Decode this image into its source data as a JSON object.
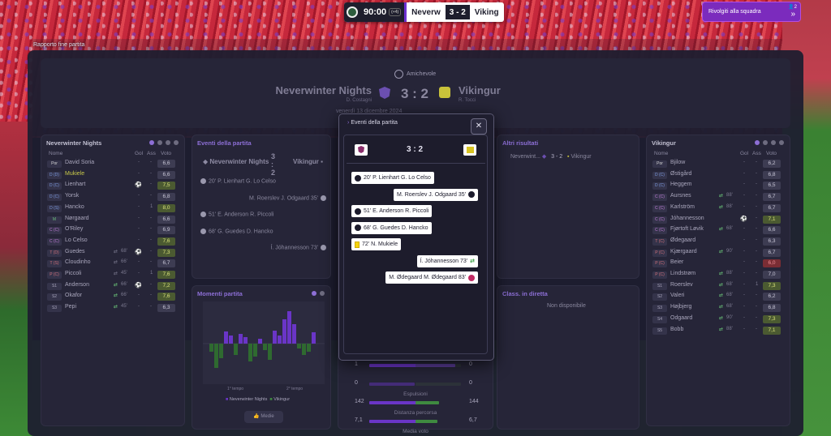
{
  "breadcrumb": "Rapporto fine partita",
  "scoreboard": {
    "time": "90:00",
    "extra": "(+4)",
    "home": "Neverw",
    "score": "3 - 2",
    "away": "Viking"
  },
  "team_talk": {
    "label": "Rivolgiti alla squadra",
    "badge": "2"
  },
  "header": {
    "competition": "Amichevole",
    "home_team": "Neverwinter Nights",
    "home_coach": "D. Costagni",
    "away_team": "Vikingur",
    "away_coach": "R. Tocci",
    "score": "3 : 2",
    "date": "venerdì 13 dicembre 2024"
  },
  "home_panel": {
    "title": "Neverwinter Nights",
    "columns": [
      "Nome",
      "Gol",
      "Ass",
      "Voto"
    ],
    "players": [
      {
        "pos": "Por",
        "name": "David Soria",
        "gol": "-",
        "ass": "-",
        "voto": "6,6",
        "r": "n",
        "t": "gk"
      },
      {
        "pos": "D (D)",
        "name": "Mukiele",
        "gol": "-",
        "ass": "-",
        "voto": "6,6",
        "r": "n",
        "t": "def",
        "hl": true
      },
      {
        "pos": "D (C)",
        "name": "Lienhart",
        "gol": "",
        "ass": "-",
        "voto": "7,5",
        "r": "g",
        "t": "def",
        "ball": true
      },
      {
        "pos": "D (C)",
        "name": "Yorsk",
        "gol": "-",
        "ass": "-",
        "voto": "6,8",
        "r": "n",
        "t": "def"
      },
      {
        "pos": "D (S)",
        "name": "Hancko",
        "gol": "-",
        "ass": "1",
        "voto": "8,0",
        "r": "g",
        "t": "def"
      },
      {
        "pos": "M",
        "name": "Nørgaard",
        "gol": "-",
        "ass": "-",
        "voto": "6,6",
        "r": "n",
        "t": "mid"
      },
      {
        "pos": "C (C)",
        "name": "O'Riley",
        "gol": "-",
        "ass": "-",
        "voto": "6,9",
        "r": "n",
        "t": "mixd"
      },
      {
        "pos": "C (C)",
        "name": "Lo Celso",
        "gol": "-",
        "ass": "-",
        "voto": "7,6",
        "r": "g",
        "t": "mixd"
      },
      {
        "pos": "T (D)",
        "name": "Guedes",
        "sub": "68'",
        "gol": "",
        "ass": "-",
        "voto": "7,3",
        "r": "g",
        "t": "att",
        "ball": true,
        "subout": true
      },
      {
        "pos": "T (S)",
        "name": "Cloudinho",
        "sub": "66'",
        "gol": "-",
        "ass": "-",
        "voto": "6,7",
        "r": "n",
        "t": "att",
        "subout": true
      },
      {
        "pos": "P (C)",
        "name": "Piccoli",
        "sub": "45'",
        "gol": "-",
        "ass": "1",
        "voto": "7,6",
        "r": "g",
        "t": "att",
        "subout": true
      },
      {
        "pos": "S1",
        "name": "Anderson",
        "sub": "66'",
        "gol": "",
        "ass": "-",
        "voto": "7,2",
        "r": "g",
        "t": "sub",
        "ball": true
      },
      {
        "pos": "S2",
        "name": "Okafor",
        "sub": "66'",
        "gol": "-",
        "ass": "-",
        "voto": "7,6",
        "r": "g",
        "t": "sub"
      },
      {
        "pos": "S3",
        "name": "Pepi",
        "sub": "45'",
        "gol": "-",
        "ass": "-",
        "voto": "6,3",
        "r": "n",
        "t": "sub"
      }
    ]
  },
  "away_panel": {
    "title": "Vikingur",
    "columns": [
      "Nome",
      "Gol",
      "Ass",
      "Voto"
    ],
    "players": [
      {
        "pos": "Por",
        "name": "Bjilow",
        "gol": "-",
        "ass": "-",
        "voto": "6,2",
        "r": "n",
        "t": "gk"
      },
      {
        "pos": "D (C)",
        "name": "Østigård",
        "gol": "-",
        "ass": "-",
        "voto": "6,8",
        "r": "n",
        "t": "def"
      },
      {
        "pos": "D (C)",
        "name": "Heggem",
        "gol": "-",
        "ass": "-",
        "voto": "6,5",
        "r": "n",
        "t": "def"
      },
      {
        "pos": "C (C)",
        "name": "Aursnes",
        "sub": "88'",
        "gol": "-",
        "ass": "-",
        "voto": "6,7",
        "r": "n",
        "t": "mixd"
      },
      {
        "pos": "C (C)",
        "name": "Karlström",
        "sub": "88'",
        "gol": "-",
        "ass": "-",
        "voto": "6,7",
        "r": "n",
        "t": "mixd"
      },
      {
        "pos": "C (C)",
        "name": "Jóhannesson",
        "gol": "",
        "ass": "-",
        "voto": "7,1",
        "r": "g",
        "t": "mixd",
        "ball": true
      },
      {
        "pos": "C (C)",
        "name": "Fjørtoft Løvik",
        "sub": "68'",
        "gol": "-",
        "ass": "-",
        "voto": "6,6",
        "r": "n",
        "t": "mixd"
      },
      {
        "pos": "T (C)",
        "name": "Ødegaard",
        "gol": "-",
        "ass": "-",
        "voto": "6,3",
        "r": "n",
        "t": "att"
      },
      {
        "pos": "P (C)",
        "name": "Kjærgaard",
        "sub": "90'",
        "gol": "-",
        "ass": "-",
        "voto": "6,7",
        "r": "n",
        "t": "att"
      },
      {
        "pos": "P (C)",
        "name": "Beier",
        "gol": "-",
        "ass": "-",
        "voto": "6,0",
        "r": "b",
        "t": "att"
      },
      {
        "pos": "P (C)",
        "name": "Lindstrøm",
        "sub": "88'",
        "gol": "-",
        "ass": "-",
        "voto": "7,0",
        "r": "n",
        "t": "att"
      },
      {
        "pos": "S1",
        "name": "Roerslev",
        "sub": "68'",
        "gol": "-",
        "ass": "1",
        "voto": "7,3",
        "r": "g",
        "t": "sub"
      },
      {
        "pos": "S2",
        "name": "Valeri",
        "sub": "68'",
        "gol": "-",
        "ass": "-",
        "voto": "6,2",
        "r": "n",
        "t": "sub"
      },
      {
        "pos": "S3",
        "name": "Højbjerg",
        "sub": "68'",
        "gol": "-",
        "ass": "-",
        "voto": "6,8",
        "r": "n",
        "t": "sub"
      },
      {
        "pos": "S4",
        "name": "Odgaard",
        "sub": "90'",
        "gol": "-",
        "ass": "-",
        "voto": "7,3",
        "r": "g",
        "t": "sub"
      },
      {
        "pos": "S5",
        "name": "Bobb",
        "sub": "88'",
        "gol": "-",
        "ass": "-",
        "voto": "7,1",
        "r": "g",
        "t": "sub"
      }
    ]
  },
  "events_panel": {
    "title": "Eventi della partita",
    "home": "Neverwinter Nights",
    "score": "3 : 2",
    "away": "Vikingur",
    "events": [
      {
        "side": "home",
        "text": "20' P. Lienhart G. Lo Celso"
      },
      {
        "side": "away",
        "text": "M. Roerslev J. Odgaard 35'"
      },
      {
        "side": "home",
        "text": "51' E. Anderson R. Piccoli"
      },
      {
        "side": "home",
        "text": "68' G. Guedes D. Hancko"
      },
      {
        "side": "away",
        "text": "Í. Jóhannesson 73'"
      }
    ]
  },
  "moments_panel": {
    "title": "Momenti partita",
    "first_half": "1° tempo",
    "second_half": "2° tempo",
    "legend_home": "Neverwinter Nights",
    "legend_away": "Vikingur",
    "button": "Medie"
  },
  "other_results": {
    "title": "Altri risultati",
    "home": "Neverwint...",
    "score": "3 - 2",
    "away": "Vikingur"
  },
  "live_table": {
    "title": "Class. in diretta",
    "text": "Non disponibile"
  },
  "stats": [
    {
      "home": "1",
      "away": "0",
      "label": "",
      "lf": 1.0,
      "rf": 0.0
    },
    {
      "home": "0",
      "away": "0",
      "label": "Espulsioni",
      "lf": 0.0,
      "rf": 0.0
    },
    {
      "home": "142",
      "away": "144",
      "label": "Distanza percorsa",
      "lf": 0.49,
      "rf": 0.51
    },
    {
      "home": "7,1",
      "away": "6,7",
      "label": "Media voto",
      "lf": 0.51,
      "rf": 0.49
    }
  ],
  "modal": {
    "title": "Eventi della partita",
    "score": "3 : 2",
    "close": "✕",
    "events": [
      {
        "side": "home",
        "type": "goal",
        "text": "20' P. Lienhart G. Lo Celso"
      },
      {
        "side": "away",
        "type": "goal",
        "text": "M. Roerslev J. Odgaard 35'"
      },
      {
        "side": "home",
        "type": "goal",
        "text": "51' E. Anderson R. Piccoli"
      },
      {
        "side": "home",
        "type": "goal",
        "text": "68' G. Guedes D. Hancko"
      },
      {
        "side": "home",
        "type": "card",
        "text": "72' N. Mukiele"
      },
      {
        "side": "away",
        "type": "sub",
        "text": "Í. Jóhannesson 73'"
      },
      {
        "side": "away",
        "type": "change",
        "text": "M. Ødegaard M. Ødegaard 83'"
      }
    ]
  },
  "colors": {
    "accent": "#8d6fd6",
    "home_bar": "#6a35c7",
    "away_bar": "#3f8a40",
    "card": "#f5d30b"
  }
}
